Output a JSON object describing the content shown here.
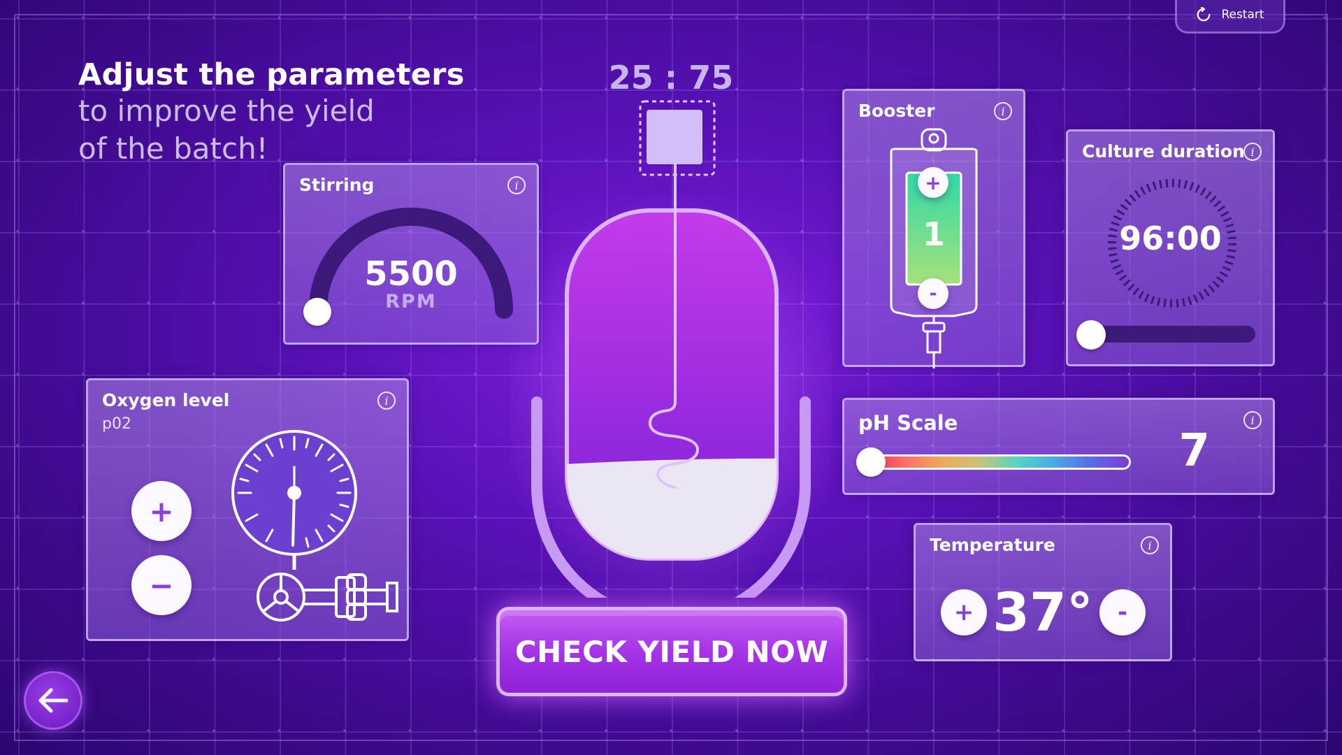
{
  "heading": {
    "title": "Adjust the parameters",
    "line2": "to improve the yield",
    "line3": "of the batch!"
  },
  "restart_label": "Restart",
  "ratio": "25 : 75",
  "stirring": {
    "title": "Stirring",
    "value": "5500",
    "unit": "RPM"
  },
  "oxygen": {
    "title": "Oxygen level",
    "subtitle": "p02",
    "plus": "+",
    "minus": "−"
  },
  "booster": {
    "title": "Booster",
    "value": "1",
    "plus": "+",
    "minus": "-"
  },
  "culture": {
    "title": "Culture duration",
    "time": "96:00"
  },
  "ph": {
    "title": "pH Scale",
    "value": "7"
  },
  "temperature": {
    "title": "Temperature",
    "value": "37°",
    "plus": "+",
    "minus": "-"
  },
  "cta_label": "CHECK YIELD NOW",
  "info_glyph": "i",
  "icons": [
    "restart-icon",
    "info-icon",
    "back-arrow-icon",
    "pressure-gauge-icon",
    "valve-wheel-icon",
    "iv-bag-icon",
    "timer-dial-icon"
  ],
  "colors": {
    "accent": "#a534e6",
    "panel_border": "#d7c3ff",
    "button_bg": "#fbf8ff",
    "button_fg": "#8a3fe0"
  }
}
